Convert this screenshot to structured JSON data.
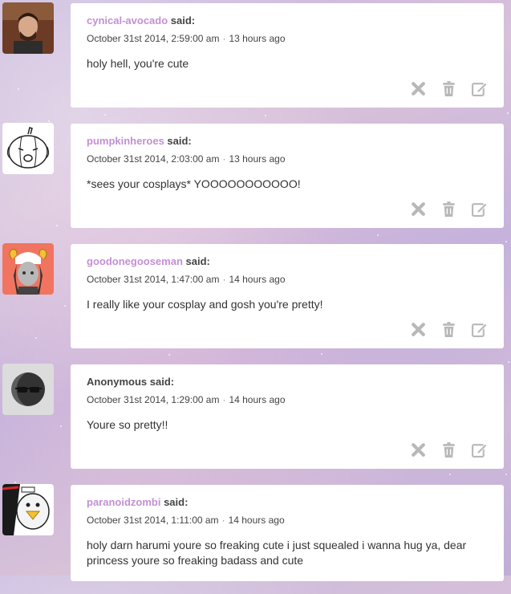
{
  "comments": [
    {
      "author": "cynical-avocado",
      "said": "said:",
      "date": "October 31st 2014, 2:59:00 am",
      "separator": "·",
      "ago": "13 hours ago",
      "text": "holy hell, you're cute",
      "avatar_icon": "user-photo-avatar"
    },
    {
      "author": "pumpkinheroes",
      "said": "said:",
      "date": "October 31st 2014, 2:03:00 am",
      "separator": "·",
      "ago": "13 hours ago",
      "text": "*sees your cosplays* YOOOOOOOOOOO!",
      "avatar_icon": "pumpkin-drawing-avatar"
    },
    {
      "author": "goodonegooseman",
      "said": "said:",
      "date": "October 31st 2014, 1:47:00 am",
      "separator": "·",
      "ago": "14 hours ago",
      "text": "I really like your cosplay and gosh you're pretty!",
      "avatar_icon": "troll-character-avatar"
    },
    {
      "author": "Anonymous",
      "said": "said:",
      "date": "October 31st 2014, 1:29:00 am",
      "separator": "·",
      "ago": "14 hours ago",
      "text": "Youre so pretty!!",
      "avatar_icon": "anonymous-sunglasses-avatar"
    },
    {
      "author": "paranoidzombi",
      "said": "said:",
      "date": "October 31st 2014, 1:11:00 am",
      "separator": "·",
      "ago": "14 hours ago",
      "text": "holy darn harumi youre so freaking cute i just squealed i wanna hug ya, dear princess youre so freaking badass and cute",
      "avatar_icon": "penguin-meme-avatar"
    }
  ],
  "action_icons": [
    "close-icon",
    "trash-icon",
    "edit-icon"
  ],
  "colors": {
    "author_link": "#c48fd4",
    "icon_gray": "#b8b8b8",
    "text": "#333333"
  }
}
